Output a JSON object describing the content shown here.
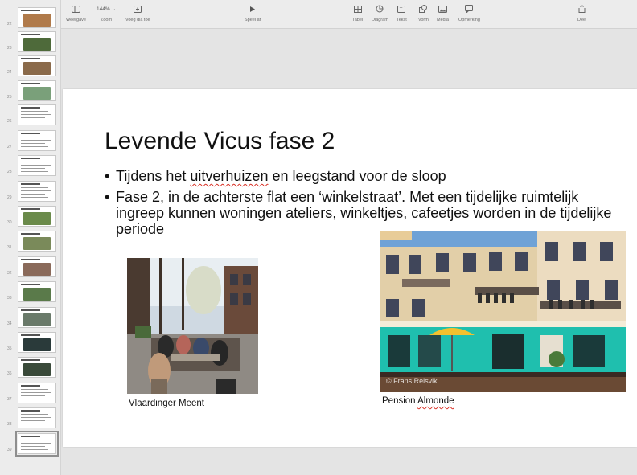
{
  "toolbar": {
    "left_items": [
      {
        "label": "Weergave",
        "icon": "sidebar-icon"
      },
      {
        "label": "Zoom",
        "value": "144%",
        "icon": "chevron-down-icon"
      },
      {
        "label": "Voeg dia toe",
        "icon": "add-slide-icon"
      }
    ],
    "play": {
      "label": "Speel af",
      "icon": "play-icon"
    },
    "insert_items": [
      {
        "label": "Tabel",
        "icon": "table-icon"
      },
      {
        "label": "Diagram",
        "icon": "chart-icon"
      },
      {
        "label": "Tekst",
        "icon": "text-icon"
      },
      {
        "label": "Vorm",
        "icon": "shape-icon"
      },
      {
        "label": "Media",
        "icon": "media-icon"
      },
      {
        "label": "Opmerking",
        "icon": "comment-icon"
      }
    ],
    "share": {
      "label": "Deel",
      "icon": "share-icon"
    }
  },
  "sidebar": {
    "slides": [
      {
        "number": "22"
      },
      {
        "number": "23"
      },
      {
        "number": "24"
      },
      {
        "number": "25"
      },
      {
        "number": "26"
      },
      {
        "number": "27"
      },
      {
        "number": "28"
      },
      {
        "number": "29"
      },
      {
        "number": "30"
      },
      {
        "number": "31"
      },
      {
        "number": "32"
      },
      {
        "number": "33"
      },
      {
        "number": "34"
      },
      {
        "number": "35"
      },
      {
        "number": "36"
      },
      {
        "number": "37"
      },
      {
        "number": "38"
      },
      {
        "number": "39"
      }
    ]
  },
  "slide": {
    "title": "Levende Vicus fase 2",
    "bullet_marker": "•",
    "bullet1": {
      "before": "Tijdens het ",
      "underlined": "uitverhuizen",
      "after": " en leegstand voor de sloop"
    },
    "bullet2": "Fase 2, in de achterste flat een ‘winkelstraat’. Met een tijdelijke ruimtelijk ingreep kunnen woningen ateliers, winkeltjes, cafeetjes worden in de tijdelijke periode",
    "caption_left": "Vlaardinger Meent",
    "caption_right_prefix": "Pension ",
    "caption_right_underlined": "Almonde",
    "photo_watermark": "© Frans Reisvik"
  }
}
